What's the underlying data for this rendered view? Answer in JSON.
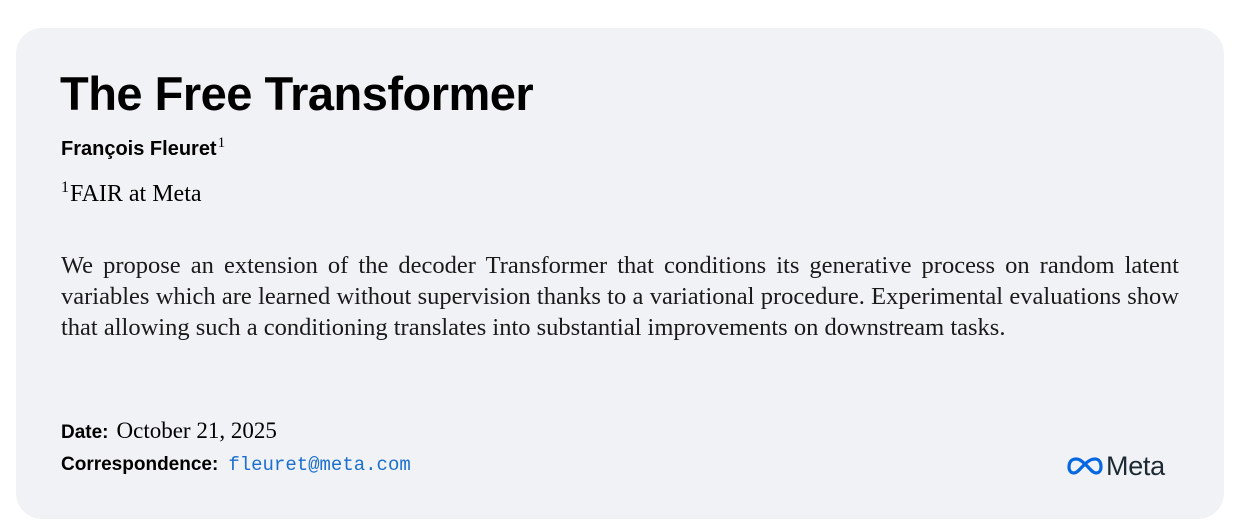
{
  "paper": {
    "title": "The Free Transformer",
    "author": "François Fleuret",
    "author_superscript": "1",
    "affiliation_superscript": "1",
    "affiliation": "FAIR at Meta",
    "abstract": "We propose an extension of the decoder Transformer that conditions its generative process on random latent variables which are learned without supervision thanks to a variational procedure. Experimental evaluations show that allowing such a conditioning translates into substantial improvements on downstream tasks.",
    "date_label": "Date:",
    "date_value": "October 21, 2025",
    "correspondence_label": "Correspondence:",
    "correspondence_email": "fleuret@meta.com"
  },
  "logo": {
    "text": "Meta",
    "icon": "meta-infinity-icon",
    "color": "#0668e1"
  },
  "colors": {
    "card_background": "#f1f2f6",
    "link": "#1b6fcf"
  }
}
